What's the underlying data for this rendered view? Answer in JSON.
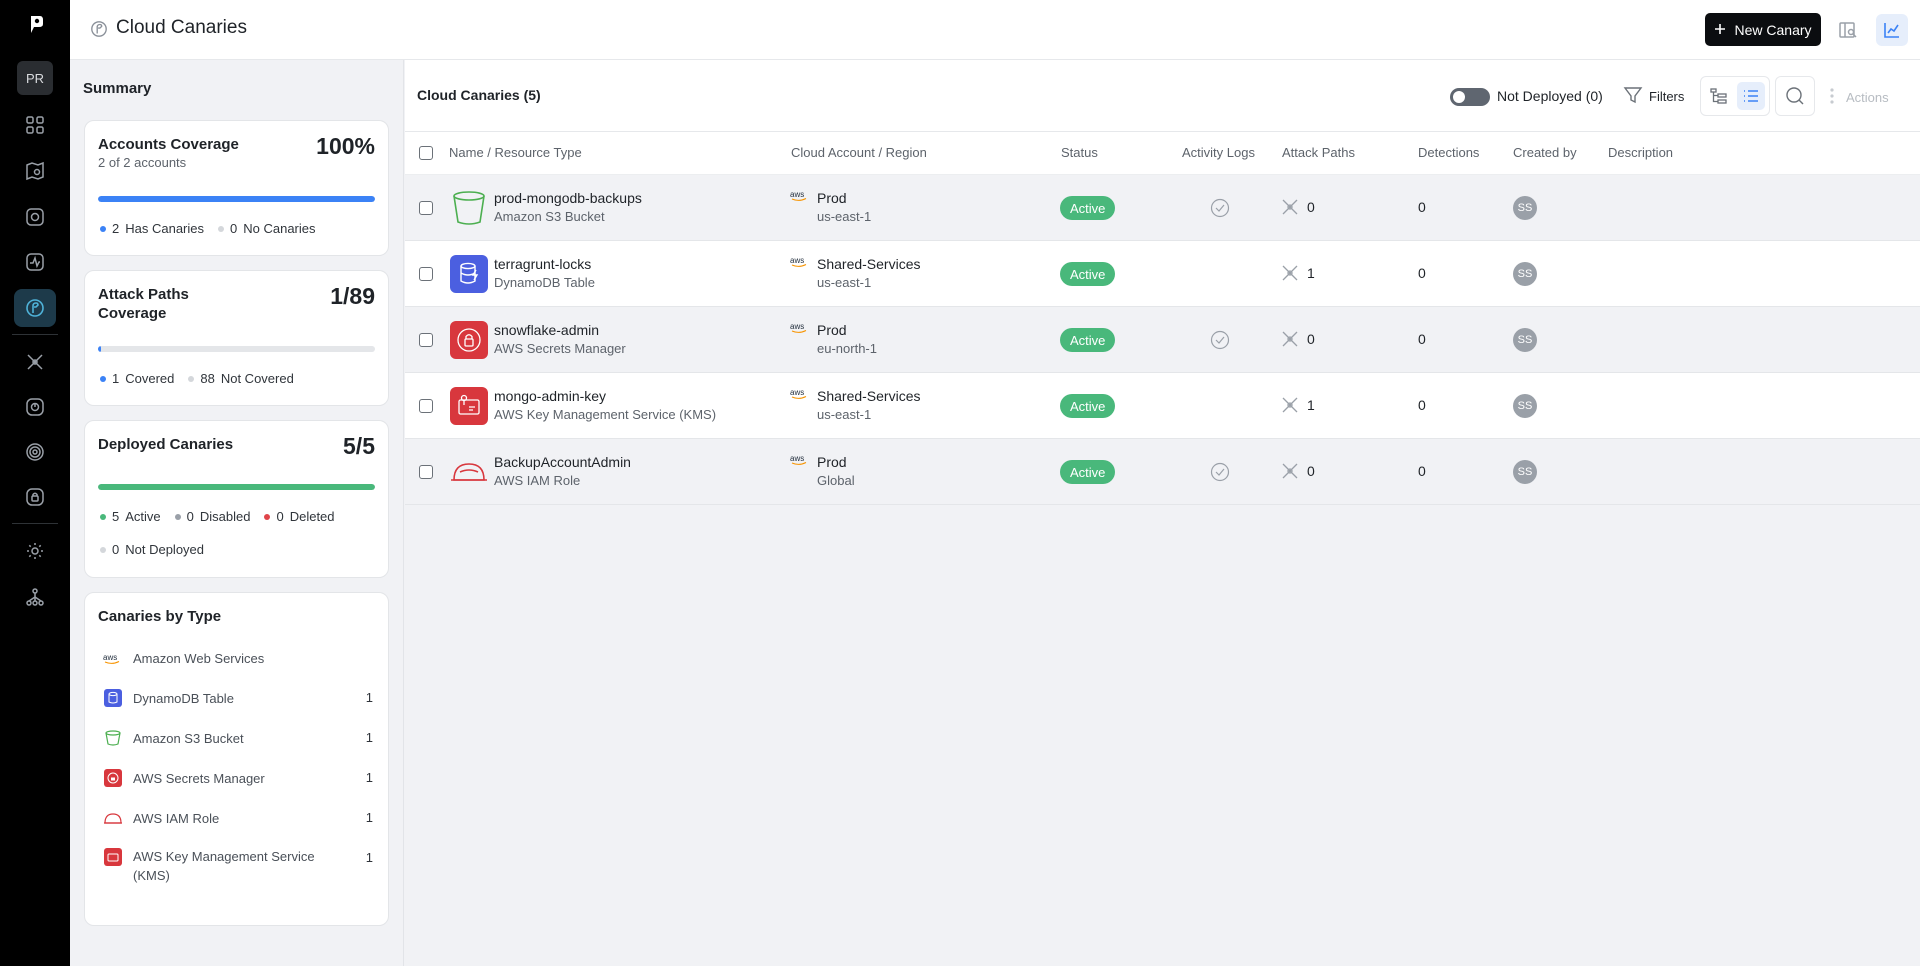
{
  "rail": {
    "workspace_initials": "PR"
  },
  "header": {
    "title": "Cloud Canaries",
    "new_button_label": "New Canary"
  },
  "summary": {
    "heading": "Summary",
    "accounts": {
      "title": "Accounts Coverage",
      "subtitle": "2 of 2 accounts",
      "value": "100%",
      "fill_fraction": 1.0,
      "legend": [
        {
          "count": "2",
          "label": "Has Canaries",
          "color": "#3b82f6"
        },
        {
          "count": "0",
          "label": "No Canaries",
          "color": "#d4d7db"
        }
      ]
    },
    "attack_paths": {
      "title": "Attack Paths Coverage",
      "value": "1/89",
      "fill_fraction": 0.011,
      "legend": [
        {
          "count": "1",
          "label": "Covered",
          "color": "#3b82f6"
        },
        {
          "count": "88",
          "label": "Not Covered",
          "color": "#d4d7db"
        }
      ]
    },
    "deployed": {
      "title": "Deployed Canaries",
      "value": "5/5",
      "fill_fraction": 1.0,
      "legend": [
        {
          "count": "5",
          "label": "Active",
          "color": "#49b87b"
        },
        {
          "count": "0",
          "label": "Disabled",
          "color": "#9aa0a8"
        },
        {
          "count": "0",
          "label": "Deleted",
          "color": "#e0454a"
        },
        {
          "count": "0",
          "label": "Not Deployed",
          "color": "#d4d7db"
        }
      ]
    },
    "by_type": {
      "title": "Canaries by Type",
      "provider": "Amazon Web Services",
      "items": [
        {
          "label": "DynamoDB Table",
          "count": "1"
        },
        {
          "label": "Amazon S3 Bucket",
          "count": "1"
        },
        {
          "label": "AWS Secrets Manager",
          "count": "1"
        },
        {
          "label": "AWS IAM Role",
          "count": "1"
        },
        {
          "label": "AWS Key Management Service (KMS)",
          "count": "1"
        }
      ]
    }
  },
  "table": {
    "title": "Cloud Canaries (5)",
    "toggle_label": "Not Deployed (0)",
    "filters_label": "Filters",
    "actions_label": "Actions",
    "columns": [
      "Name / Resource Type",
      "Cloud Account / Region",
      "Status",
      "Activity Logs",
      "Attack Paths",
      "Detections",
      "Created by",
      "Description"
    ],
    "rows": [
      {
        "name": "prod-mongodb-backups",
        "type": "Amazon S3 Bucket",
        "account": "Prod",
        "region": "us-east-1",
        "status": "Active",
        "activity_logs": true,
        "attack_paths": "0",
        "detections": "0",
        "created_by": "SS",
        "icon": "s3-bucket-icon"
      },
      {
        "name": "terragrunt-locks",
        "type": "DynamoDB Table",
        "account": "Shared-Services",
        "region": "us-east-1",
        "status": "Active",
        "activity_logs": false,
        "attack_paths": "1",
        "detections": "0",
        "created_by": "SS",
        "icon": "dynamodb-icon"
      },
      {
        "name": "snowflake-admin",
        "type": "AWS Secrets Manager",
        "account": "Prod",
        "region": "eu-north-1",
        "status": "Active",
        "activity_logs": true,
        "attack_paths": "0",
        "detections": "0",
        "created_by": "SS",
        "icon": "secrets-manager-icon"
      },
      {
        "name": "mongo-admin-key",
        "type": "AWS Key Management Service (KMS)",
        "account": "Shared-Services",
        "region": "us-east-1",
        "status": "Active",
        "activity_logs": false,
        "attack_paths": "1",
        "detections": "0",
        "created_by": "SS",
        "icon": "kms-icon"
      },
      {
        "name": "BackupAccountAdmin",
        "type": "AWS IAM Role",
        "account": "Prod",
        "region": "Global",
        "status": "Active",
        "activity_logs": true,
        "attack_paths": "0",
        "detections": "0",
        "created_by": "SS",
        "icon": "iam-role-icon"
      }
    ]
  },
  "aws_logo_text": "aws",
  "colors": {
    "accent": "#3b82f6",
    "active": "#49b87b",
    "rail": "#000000"
  }
}
